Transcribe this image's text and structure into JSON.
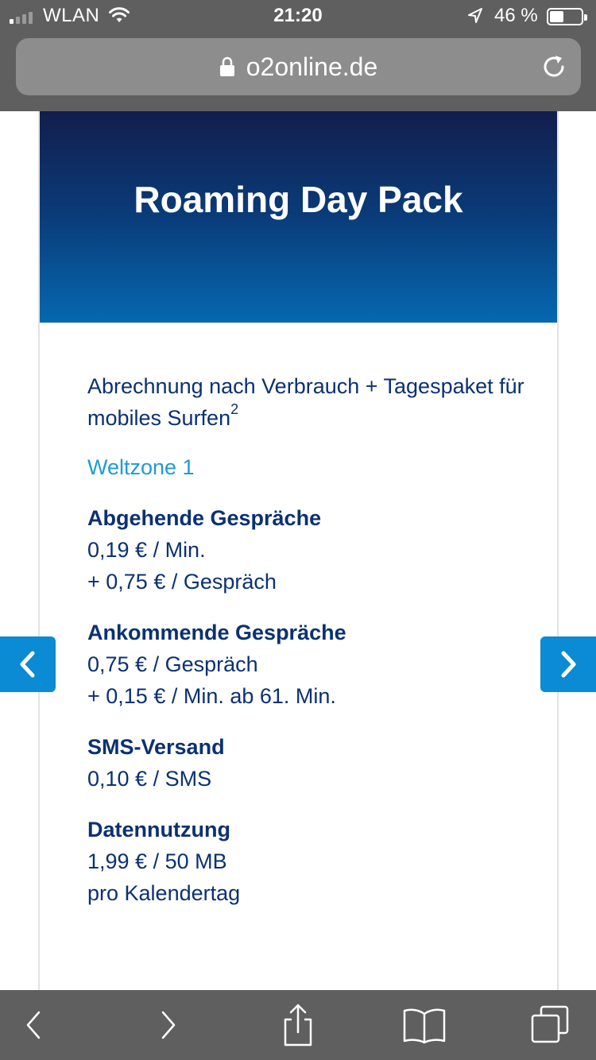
{
  "status_bar": {
    "carrier": "WLAN",
    "time": "21:20",
    "battery": "46 %",
    "battery_level": 0.46
  },
  "browser": {
    "url": "o2online.de"
  },
  "card": {
    "title": "Roaming Day Pack",
    "intro_text": "Abrechnung nach Verbrauch + Tagespaket für mobiles Surfen",
    "intro_footnote": "2",
    "zone": "Weltzone 1",
    "sections": [
      {
        "heading": "Abgehende Gespräche",
        "lines": [
          "0,19 € / Min.",
          "+ 0,75 € / Gespräch"
        ]
      },
      {
        "heading": "Ankommende Gespräche",
        "lines": [
          "0,75 € / Gespräch",
          "+ 0,15 € / Min. ab 61. Min."
        ]
      },
      {
        "heading": "SMS-Versand",
        "lines": [
          "0,10 € / SMS"
        ]
      },
      {
        "heading": "Datennutzung",
        "lines": [
          "1,99 € / 50 MB",
          "pro Kalendertag"
        ]
      }
    ]
  },
  "colors": {
    "brand_blue": "#0a3171",
    "accent_blue": "#1f9bd0",
    "arrow_blue": "#0a8bd4"
  },
  "icons": {
    "lock": "lock-icon",
    "reload": "reload-icon",
    "prev": "chevron-left-icon",
    "next": "chevron-right-icon",
    "back": "back-icon",
    "forward": "forward-icon",
    "share": "share-icon",
    "bookmarks": "bookmarks-icon",
    "tabs": "tabs-icon"
  }
}
